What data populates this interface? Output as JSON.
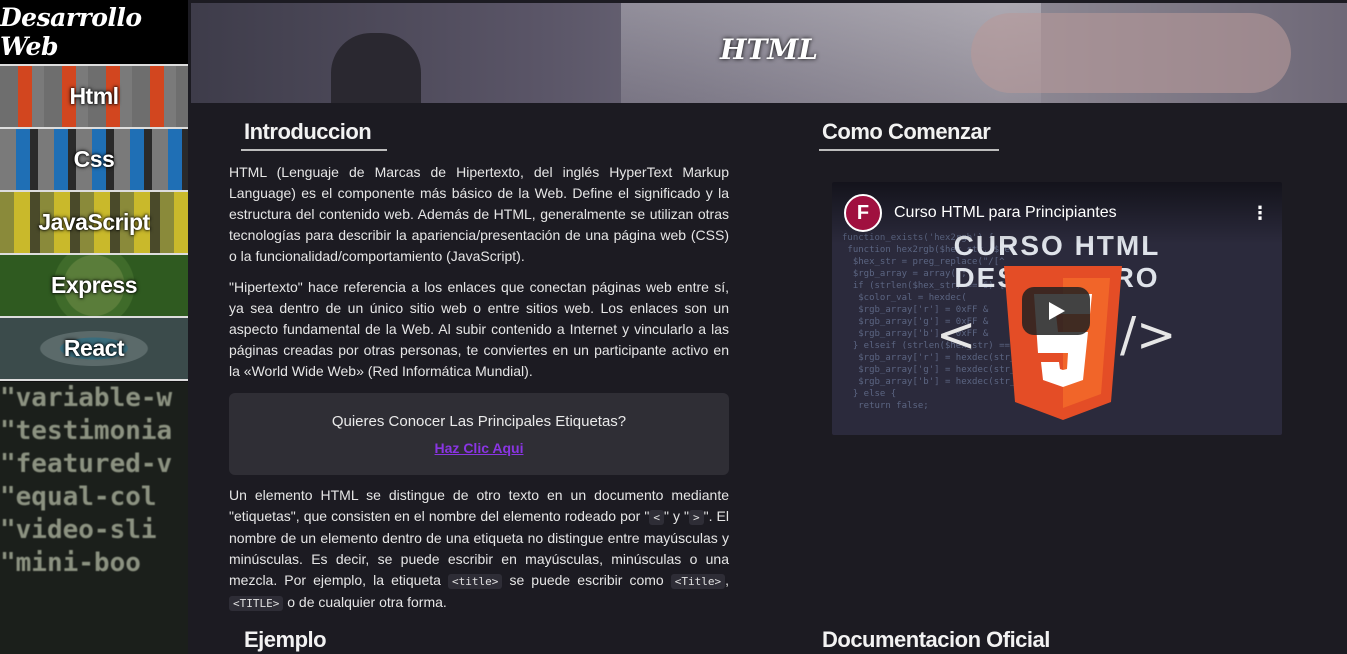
{
  "sidebar": {
    "brand": "Desarrollo Web",
    "items": [
      {
        "label": "Html",
        "bg": "bg-html"
      },
      {
        "label": "Css",
        "bg": "bg-css"
      },
      {
        "label": "JavaScript",
        "bg": "bg-js"
      },
      {
        "label": "Express",
        "bg": "bg-express"
      },
      {
        "label": "React",
        "bg": "bg-react"
      }
    ],
    "code_lines": [
      "\"variable-w",
      "\"testimonia",
      "\"featured-v",
      "\"equal-col",
      "\"video-sli",
      "\"mini-boo"
    ]
  },
  "banner": {
    "title": "HTML"
  },
  "intro": {
    "title": "Introduccion",
    "p1": "HTML (Lenguaje de Marcas de Hipertexto, del inglés HyperText Markup Language) es el componente más básico de la Web. Define el significado y la estructura del contenido web. Además de HTML, generalmente se utilizan otras tecnologías para describir la apariencia/presentación de una página web (CSS) o la funcionalidad/comportamiento (JavaScript).",
    "p2": "\"Hipertexto\" hace referencia a los enlaces que conectan páginas web entre sí, ya sea dentro de un único sitio web o entre sitios web. Los enlaces son un aspecto fundamental de la Web. Al subir contenido a Internet y vincularlo a las páginas creadas por otras personas, te conviertes en un participante activo en la «World Wide Web» (Red Informática Mundial).",
    "callout_question": "Quieres Conocer Las Principales Etiquetas?",
    "callout_link": "Haz Clic Aqui",
    "p3_a": "Un elemento HTML se distingue de otro texto en un documento mediante \"etiquetas\", que consisten en el nombre del elemento rodeado por \"",
    "lt": "<",
    "p3_b": "\" y \"",
    "gt": ">",
    "p3_c": "\". El nombre de un elemento dentro de una etiqueta no distingue entre mayúsculas y minúsculas. Es decir, se puede escribir en mayúsculas, minúsculas o una mezcla. Por ejemplo, la etiqueta",
    "tag1": "<title>",
    "p3_d": "se puede escribir como",
    "tag2": "<Title>",
    "p3_e": ",",
    "tag3": "<TITLE>",
    "p3_f": "o de cualquier otra forma."
  },
  "start": {
    "title": "Como Comenzar",
    "video": {
      "channel_initial": "F",
      "title": "Curso HTML para Principiantes",
      "more": "⋮",
      "thumb_line1": "CURSO HTML",
      "thumb_line2": "DESDE CERO",
      "lt": "<",
      "gt": "/>"
    }
  },
  "bottom": {
    "example_title": "Ejemplo",
    "docs_title": "Documentacion Oficial"
  },
  "colors": {
    "accent_link": "#8a35e3",
    "html5_orange": "#e44d26",
    "html5_orange_light": "#f16529"
  }
}
